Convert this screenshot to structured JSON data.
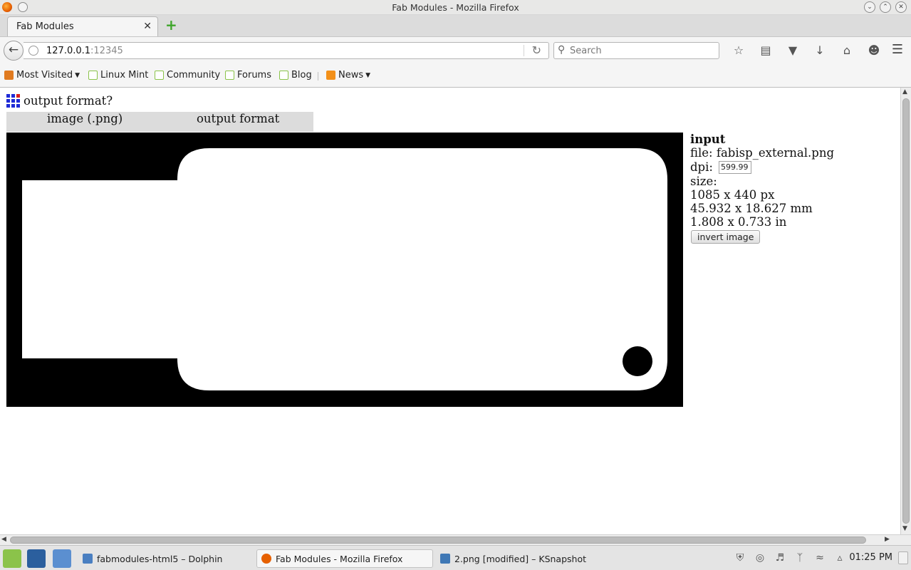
{
  "window": {
    "title": "Fab Modules - Mozilla Firefox"
  },
  "tab": {
    "label": "Fab Modules",
    "close_glyph": "✕",
    "new_glyph": "+"
  },
  "nav": {
    "url_host": "127.0.0.1",
    "url_port": ":12345",
    "search_placeholder": "Search",
    "icons": [
      "bookmark-star-icon",
      "reading-list-icon",
      "pocket-icon",
      "download-icon",
      "home-icon",
      "chat-icon"
    ]
  },
  "bookmarks": [
    {
      "label": "Most Visited",
      "icon": "most-visited-icon",
      "dropdown": true
    },
    {
      "label": "Linux Mint",
      "icon": "mint-icon",
      "dropdown": false
    },
    {
      "label": "Community",
      "icon": "mint-icon",
      "dropdown": false
    },
    {
      "label": "Forums",
      "icon": "mint-icon",
      "dropdown": false
    },
    {
      "label": "Blog",
      "icon": "mint-icon",
      "dropdown": false
    },
    {
      "label": "News",
      "icon": "rss-icon",
      "dropdown": true
    }
  ],
  "page": {
    "prompt": "output format?",
    "modules": [
      "image (.png)",
      "output format"
    ],
    "input": {
      "heading": "input",
      "file_label": "file:",
      "file_name": "fabisp_external.png",
      "dpi_label": "dpi:",
      "dpi_value": "599.99",
      "size_label": "size:",
      "size_px": "1085 x 440 px",
      "size_mm": "45.932 x 18.627 mm",
      "size_in": "1.808 x 0.733 in",
      "invert_label": "invert image"
    }
  },
  "taskbar": {
    "tasks": [
      {
        "label": "fabmodules-html5 – Dolphin",
        "active": false
      },
      {
        "label": "Fab Modules - Mozilla Firefox",
        "active": true
      },
      {
        "label": "2.png [modified] – KSnapshot",
        "active": false
      }
    ],
    "clock": "01:25 PM"
  },
  "colors": {
    "logo_blue": "#1f2bd6",
    "logo_red": "#d81f1f",
    "module_bar": "#dcdcdc",
    "mint_green": "#8bc34a"
  }
}
